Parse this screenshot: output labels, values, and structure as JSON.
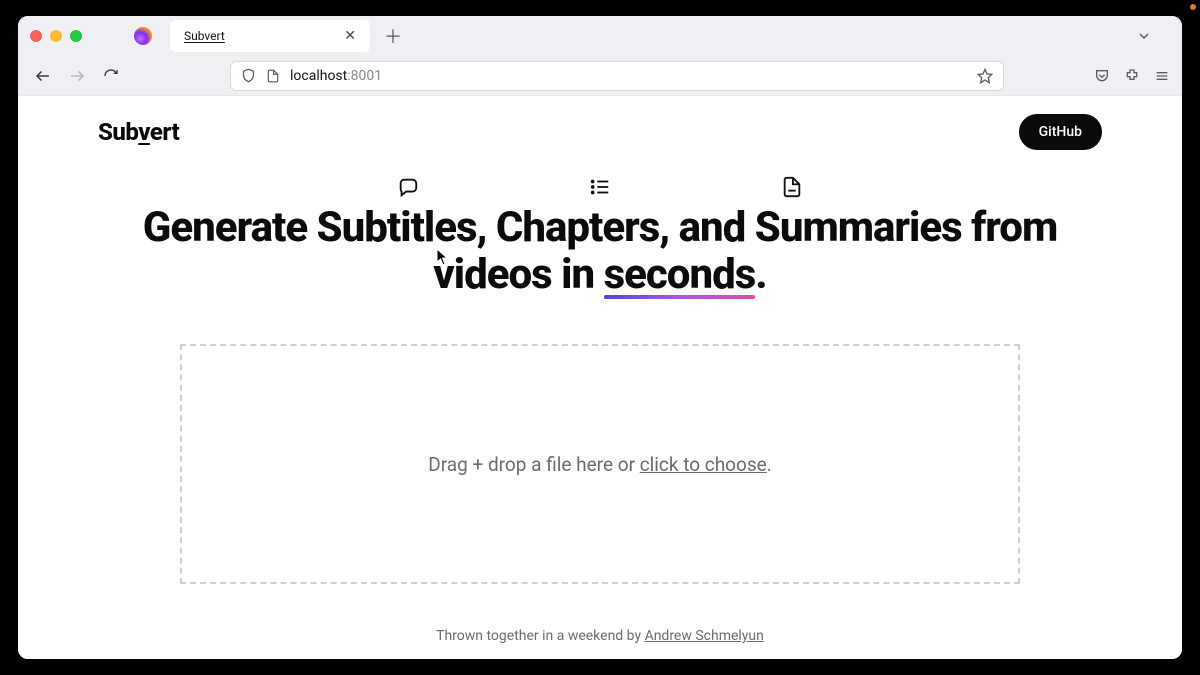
{
  "browser": {
    "tab_title": "Subvert",
    "url_host": "localhost",
    "url_port": ":8001"
  },
  "page": {
    "brand_prefix": "Sub",
    "brand_under": "v",
    "brand_suffix": "ert",
    "github_button": "GitHub",
    "hero_line1_a": "Generate Subtitles, Chapters, and Summaries from",
    "hero_line2_prefix": "videos in ",
    "hero_line2_seconds": "seconds",
    "hero_line2_suffix": ".",
    "drop_prefix": "Drag + drop a file here or ",
    "drop_choose": "click to choose",
    "drop_suffix": ".",
    "footer_prefix": "Thrown together in a weekend by ",
    "footer_author": "Andrew Schmelyun"
  }
}
